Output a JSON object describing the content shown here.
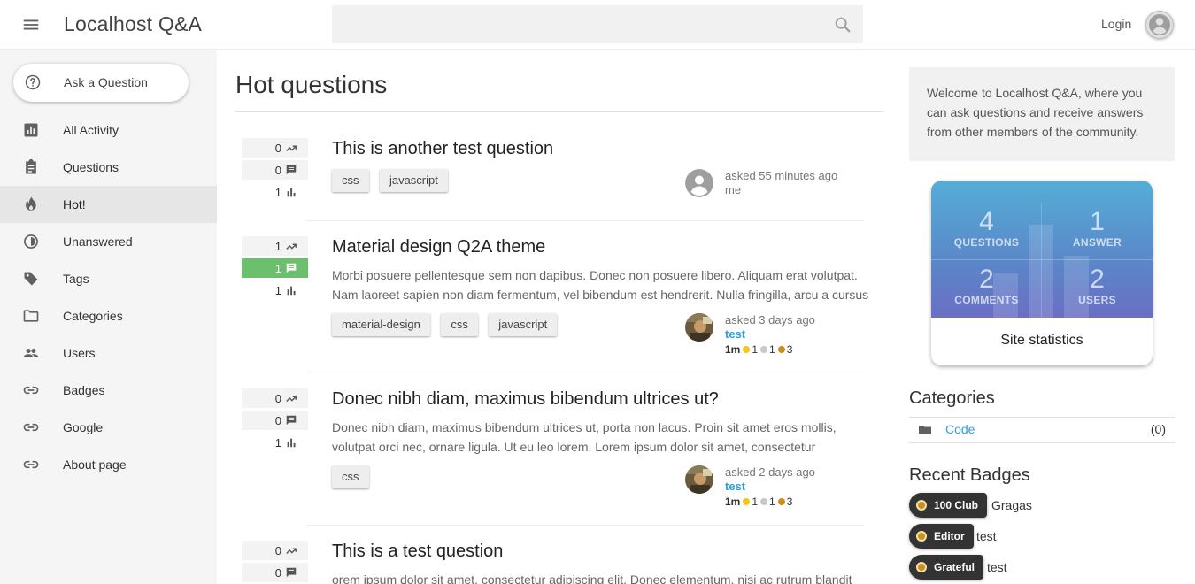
{
  "header": {
    "site_title": "Localhost Q&A",
    "search_placeholder": "",
    "login_label": "Login"
  },
  "sidebar": {
    "ask_label": "Ask a Question",
    "items": [
      {
        "label": "All Activity",
        "icon": "bar-chart-icon"
      },
      {
        "label": "Questions",
        "icon": "clipboard-icon"
      },
      {
        "label": "Hot!",
        "icon": "flame-icon",
        "active": true
      },
      {
        "label": "Unanswered",
        "icon": "half-circle-icon"
      },
      {
        "label": "Tags",
        "icon": "tag-icon"
      },
      {
        "label": "Categories",
        "icon": "folder-icon"
      },
      {
        "label": "Users",
        "icon": "people-icon"
      },
      {
        "label": "Badges",
        "icon": "link-icon"
      },
      {
        "label": "Google",
        "icon": "link-icon"
      },
      {
        "label": "About page",
        "icon": "link-icon"
      }
    ]
  },
  "main": {
    "title": "Hot questions",
    "questions": [
      {
        "title": "This is another test question",
        "excerpt": "",
        "tags": [
          "css",
          "javascript"
        ],
        "votes": "0",
        "answers": "0",
        "views": "1",
        "answered": false,
        "asked": "asked 55 minutes ago",
        "author": "me"
      },
      {
        "title": "Material design Q2A theme",
        "excerpt_line1": "Morbi posuere pellentesque sem non dapibus. Donec non posuere libero. Aliquam erat volutpat.",
        "excerpt_line2": "Nam laoreet sapien non diam fermentum, vel bibendum est hendrerit. Nulla fringilla, arcu a cursus",
        "tags": [
          "material-design",
          "css",
          "javascript"
        ],
        "votes": "1",
        "answers": "1",
        "views": "1",
        "answered": true,
        "asked": "asked 3 days ago",
        "author": "test",
        "points": "1m",
        "gold": "1",
        "silver": "1",
        "bronze": "3"
      },
      {
        "title": "Donec nibh diam, maximus bibendum ultrices ut?",
        "excerpt_line1": "Donec nibh diam, maximus bibendum ultrices ut, porta non lacus. Proin sit amet eros mollis,",
        "excerpt_line2": "volutpat orci nec, ornare ligula. Ut eu leo lorem. Lorem ipsum dolor sit amet, consectetur",
        "tags": [
          "css"
        ],
        "votes": "0",
        "answers": "0",
        "views": "1",
        "answered": false,
        "asked": "asked 2 days ago",
        "author": "test",
        "points": "1m",
        "gold": "1",
        "silver": "1",
        "bronze": "3"
      },
      {
        "title": "This is a test question",
        "excerpt_line1": "orem ipsum dolor sit amet, consectetur adipiscing elit. Donec elementum, nisi ac rutrum blandit",
        "votes": "0",
        "answers": "0"
      }
    ]
  },
  "right": {
    "welcome": "Welcome to Localhost Q&A, where you can ask questions and receive answers from other members of the community.",
    "stats": {
      "questions_num": "4",
      "questions_label": "QUESTIONS",
      "answers_num": "1",
      "answers_label": "ANSWER",
      "comments_num": "2",
      "comments_label": "COMMENTS",
      "users_num": "2",
      "users_label": "USERS",
      "caption": "Site statistics"
    },
    "categories_title": "Categories",
    "categories": [
      {
        "name": "Code",
        "count": "(0)"
      }
    ],
    "badges_title": "Recent Badges",
    "badges": [
      {
        "badge": "100 Club",
        "user": "Gragas"
      },
      {
        "badge": "Editor",
        "user": "test"
      },
      {
        "badge": "Grateful",
        "user": "test"
      }
    ]
  },
  "colors": {
    "answered_green": "#6cbf6c",
    "link_blue": "#2e9fd8",
    "stats_gradient_top": "#54aed6",
    "stats_gradient_bottom": "#6a6fc4",
    "badge_bronze": "#c9901e"
  }
}
